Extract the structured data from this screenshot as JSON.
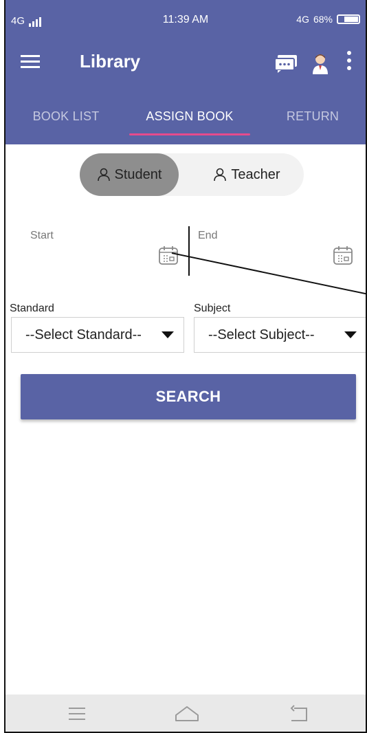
{
  "status_bar": {
    "network_left": "4G",
    "time": "11:39 AM",
    "network_right": "4G",
    "battery_percent": "68%",
    "battery_level": 0.68
  },
  "app_bar": {
    "title": "Library",
    "menu_icon": "hamburger-menu-icon",
    "chat_icon": "chat-icon",
    "avatar_icon": "user-avatar-icon",
    "more_icon": "more-vert-icon"
  },
  "tabs": [
    {
      "label": "BOOK LIST",
      "active": false
    },
    {
      "label": "ASSIGN BOOK",
      "active": true
    },
    {
      "label": "RETURN",
      "active": false
    }
  ],
  "toggle": {
    "student_label": "Student",
    "teacher_label": "Teacher",
    "selected": "Student"
  },
  "dates": {
    "start_label": "Start",
    "end_label": "End"
  },
  "filters": {
    "standard_label": "Standard",
    "standard_value": "--Select Standard--",
    "subject_label": "Subject",
    "subject_value": "--Select Subject--"
  },
  "search_button": "SEARCH",
  "colors": {
    "primary": "#5963a5",
    "tab_indicator": "#e64b8c",
    "toggle_selected": "#8e8e8e",
    "toggle_bg": "#f2f2f2"
  }
}
